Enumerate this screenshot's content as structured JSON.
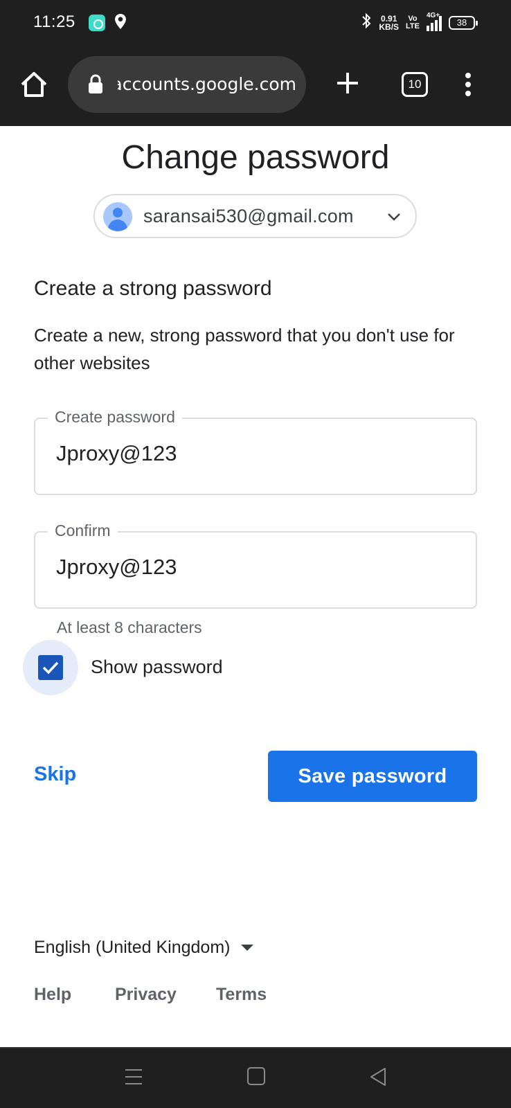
{
  "status_bar": {
    "time": "11:25",
    "net_speed_value": "0.91",
    "net_speed_unit": "KB/S",
    "volte_top": "Vo",
    "volte_bottom": "LTE",
    "network": "4G+",
    "battery": "38",
    "icons": [
      "app-notification-icon",
      "location-icon",
      "bluetooth-icon",
      "signal-icon",
      "battery-icon"
    ]
  },
  "browser": {
    "url": "accounts.google.com",
    "tab_count": "10",
    "icons": [
      "home-icon",
      "lock-icon",
      "new-tab-icon",
      "tab-switcher-icon",
      "more-menu-icon"
    ]
  },
  "page": {
    "title": "Change password",
    "account_email": "saransai530@gmail.com",
    "section_title": "Create a strong password",
    "section_desc": "Create a new, strong password that you don't use for other websites",
    "create_password": {
      "label": "Create password",
      "value": "Jproxy@123"
    },
    "confirm_password": {
      "label": "Confirm",
      "value": "Jproxy@123"
    },
    "hint": "At least 8 characters",
    "show_password": {
      "label": "Show password",
      "checked": true
    },
    "skip_label": "Skip",
    "save_label": "Save password",
    "accent_color": "#1a73e8"
  },
  "footer": {
    "language": "English (United Kingdom)",
    "links": [
      "Help",
      "Privacy",
      "Terms"
    ]
  },
  "nav_bar": {
    "icons": [
      "recents-icon",
      "home-nav-icon",
      "back-icon"
    ]
  }
}
